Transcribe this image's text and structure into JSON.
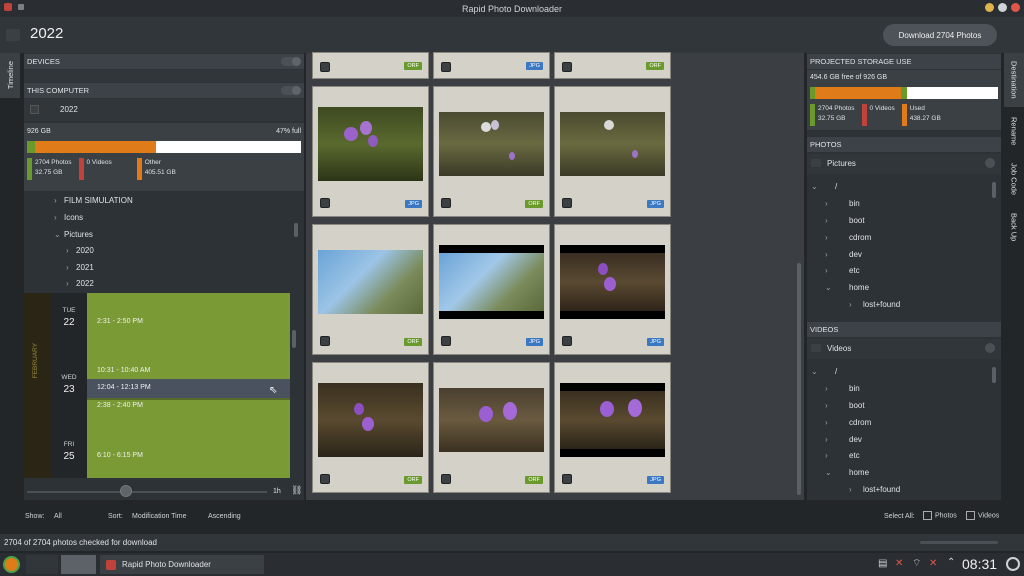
{
  "window": {
    "title": "Rapid Photo Downloader"
  },
  "header": {
    "year": "2022",
    "download_label": "Download 2704 Photos"
  },
  "left_tab": {
    "label": "Timeline"
  },
  "devices": {
    "title": "DEVICES"
  },
  "this_computer": {
    "title": "THIS COMPUTER",
    "item": "2022",
    "capacity": "926 GB",
    "percent_full": "47% full",
    "fill_fraction": 0.47,
    "legend": [
      {
        "label": "2704 Photos",
        "value": "32.75 GB",
        "color": "#6a9a2c"
      },
      {
        "label": "0 Videos",
        "value": "",
        "color": "#c0433b"
      },
      {
        "label": "Other",
        "value": "405.51 GB",
        "color": "#e07b1a"
      }
    ],
    "tree": [
      "FILM SIMULATION",
      "Icons",
      "Pictures",
      "2020",
      "2021",
      "2022"
    ]
  },
  "timeline": {
    "month": "FEBRUARY",
    "days": [
      {
        "dow": "TUE",
        "num": "22"
      },
      {
        "dow": "WED",
        "num": "23"
      },
      {
        "dow": "FRI",
        "num": "25"
      }
    ],
    "slots": [
      "2:31 - 2:50 PM",
      "10:31 - 10:40 AM",
      "12:04 - 12:13 PM",
      "2:38 - 2:40 PM",
      "6:10 - 6:15 PM"
    ],
    "zoom": "1h"
  },
  "grid": {
    "top_badges": [
      "ORF",
      "JPG",
      "ORF"
    ],
    "rows": [
      [
        "JPG",
        "ORF",
        "JPG"
      ],
      [
        "ORF",
        "JPG",
        "JPG"
      ],
      [
        "ORF",
        "ORF",
        "JPG"
      ]
    ]
  },
  "storage": {
    "title": "PROJECTED STORAGE USE",
    "free": "454.6 GB free of 926 GB",
    "legend": [
      {
        "label": "2704 Photos",
        "value": "32.75 GB",
        "color": "#6a9a2c"
      },
      {
        "label": "0 Videos",
        "value": "",
        "color": "#c0433b"
      },
      {
        "label": "Used",
        "value": "438.27 GB",
        "color": "#e07b1a"
      }
    ]
  },
  "photos": {
    "title": "PHOTOS",
    "folder": "Pictures",
    "tree": [
      "/",
      "bin",
      "boot",
      "cdrom",
      "dev",
      "etc",
      "home",
      "lost+found"
    ]
  },
  "videos": {
    "title": "VIDEOS",
    "folder": "Videos",
    "tree": [
      "/",
      "bin",
      "boot",
      "cdrom",
      "dev",
      "etc",
      "home",
      "lost+found"
    ]
  },
  "right_tabs": [
    "Destination",
    "Rename",
    "Job Code",
    "Back Up"
  ],
  "bottom": {
    "show_label": "Show:",
    "show_value": "All",
    "sort_label": "Sort:",
    "sort_value": "Modification Time",
    "order_value": "Ascending",
    "select_all": "Select All:",
    "photos": "Photos",
    "videos": "Videos"
  },
  "status": {
    "text": "2704 of 2704 photos checked for download"
  },
  "taskbar": {
    "app": "Rapid Photo Downloader",
    "clock": "08:31"
  }
}
